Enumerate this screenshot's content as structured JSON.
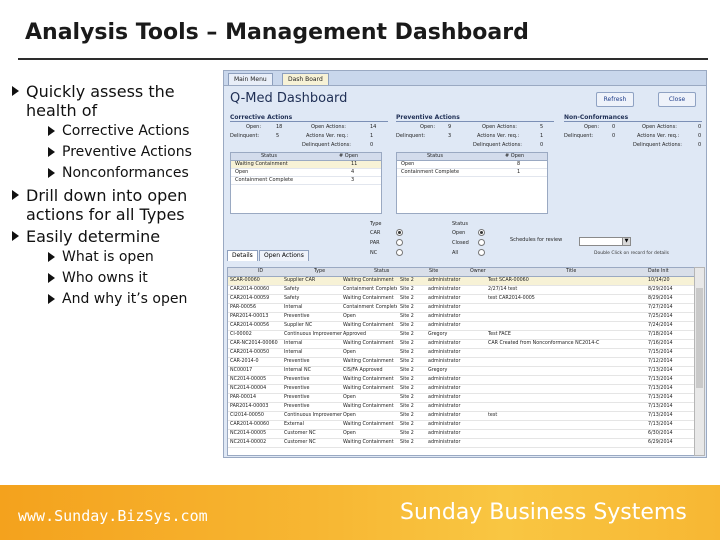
{
  "slide": {
    "title": "Analysis Tools – Management Dashboard",
    "bullets": [
      {
        "text": "Quickly assess the health of",
        "sub": [
          "Corrective Actions",
          "Preventive Actions",
          "Nonconformances"
        ]
      },
      {
        "text": "Drill down into open actions for all Types",
        "sub": []
      },
      {
        "text": "Easily determine",
        "sub": [
          "What is open",
          "Who owns it",
          "And why it’s open"
        ]
      }
    ],
    "footer_url": "www.Sunday.BizSys.com",
    "footer_company": "Sunday Business Systems"
  },
  "app": {
    "tabs": [
      "Main Menu",
      "Dash Board"
    ],
    "title": "Q-Med Dashboard",
    "refresh_label": "Refresh",
    "close_label": "Close",
    "sections": {
      "corrective": {
        "title": "Corrective Actions",
        "open_label": "Open:",
        "open_value": "18",
        "delinquent_label": "Delinquent:",
        "delinquent_value": "5",
        "open_actions_label": "Open Actions:",
        "open_actions_value": "14",
        "actions_ver_label": "Actions Ver. req.:",
        "actions_ver_value": "1",
        "delinquent_actions_label": "Delinquent Actions:",
        "delinquent_actions_value": "0",
        "cols": [
          "Status",
          "# Open"
        ],
        "rows": [
          [
            "Waiting Containment",
            "11"
          ],
          [
            "Open",
            "4"
          ],
          [
            "Containment Complete",
            "3"
          ]
        ]
      },
      "preventive": {
        "title": "Preventive Actions",
        "open_label": "Open:",
        "open_value": "9",
        "delinquent_label": "Delinquent:",
        "delinquent_value": "3",
        "open_actions_label": "Open Actions:",
        "open_actions_value": "5",
        "actions_ver_label": "Actions Ver. req.:",
        "actions_ver_value": "1",
        "delinquent_actions_label": "Delinquent Actions:",
        "delinquent_actions_value": "0",
        "cols": [
          "Status",
          "# Open"
        ],
        "rows": [
          [
            "Open",
            "8"
          ],
          [
            "Containment Complete",
            "1"
          ]
        ]
      },
      "nonconformances": {
        "title": "Non-Conformances",
        "open_label": "Open:",
        "open_value": "0",
        "delinquent_label": "Delinquent:",
        "delinquent_value": "0",
        "open_actions_label": "Open Actions:",
        "open_actions_value": "0",
        "actions_ver_label": "Actions Ver. req.:",
        "actions_ver_value": "0",
        "delinquent_actions_label": "Delinquent Actions:",
        "delinquent_actions_value": "0"
      }
    },
    "type_filter": {
      "label": "Type",
      "options": [
        "CAR",
        "PAR",
        "NC"
      ]
    },
    "status_filter": {
      "label": "Status",
      "options": [
        "Open",
        "Closed",
        "All"
      ]
    },
    "schedule_label": "Schedules for review",
    "note": "Double Click on record for details",
    "detail_tabs": [
      "Details",
      "Open Actions"
    ],
    "grid": {
      "columns": [
        "ID",
        "Type",
        "Status",
        "Site",
        "Owner",
        "Title",
        "Date Init"
      ],
      "rows": [
        [
          "SCAR-00060",
          "Supplier CAR",
          "Waiting Containment",
          "Site 2",
          "administrator",
          "Test SCAR-00060",
          "10/14/20"
        ],
        [
          "CAR2014-00060",
          "Safety",
          "Containment Complete",
          "Site 2",
          "administrator",
          "2/27/14 test",
          "8/29/2014"
        ],
        [
          "CAR2014-00059",
          "Safety",
          "Waiting Containment",
          "Site 2",
          "administrator",
          "test CAR2014-0005",
          "8/29/2014"
        ],
        [
          "PAR-00056",
          "Internal",
          "Containment Complete",
          "Site 2",
          "administrator",
          "",
          "7/27/2014"
        ],
        [
          "PAR2014-00013",
          "Preventive",
          "Open",
          "Site 2",
          "administrator",
          "",
          "7/25/2014"
        ],
        [
          "CAR2014-00056",
          "Supplier NC",
          "Waiting Containment",
          "Site 2",
          "administrator",
          "",
          "7/24/2014"
        ],
        [
          "CI-00002",
          "Continuous Improvement",
          "Approved",
          "Site 2",
          "Gregory",
          "Test FACE",
          "7/18/2014"
        ],
        [
          "CAR-NC2014-00060",
          "Internal",
          "Waiting Containment",
          "Site 2",
          "administrator",
          "CAR Created from Nonconformance NC2014-C",
          "7/16/2014"
        ],
        [
          "CAR2014-00050",
          "Internal",
          "Open",
          "Site 2",
          "administrator",
          "",
          "7/15/2014"
        ],
        [
          "CAR-2014-0",
          "Preventive",
          "Waiting Containment",
          "Site 2",
          "administrator",
          "",
          "7/12/2014"
        ],
        [
          "NC00017",
          "Internal NC",
          "CIS/FA Approved",
          "Site 2",
          "Gregory",
          "",
          "7/13/2014"
        ],
        [
          "NC2014-00005",
          "Preventive",
          "Waiting Containment",
          "Site 2",
          "administrator",
          "",
          "7/13/2014"
        ],
        [
          "NC2014-00004",
          "Preventive",
          "Waiting Containment",
          "Site 2",
          "administrator",
          "",
          "7/13/2014"
        ],
        [
          "PAR-00014",
          "Preventive",
          "Open",
          "Site 2",
          "administrator",
          "",
          "7/13/2014"
        ],
        [
          "PAR2014-00003",
          "Preventive",
          "Waiting Containment",
          "Site 2",
          "administrator",
          "",
          "7/13/2014"
        ],
        [
          "CI2014-00050",
          "Continuous Improvement",
          "Open",
          "Site 2",
          "administrator",
          "test",
          "7/13/2014"
        ],
        [
          "CAR2014-00060",
          "External",
          "Waiting Containment",
          "Site 2",
          "administrator",
          "",
          "7/13/2014"
        ],
        [
          "NC2014-00005",
          "Customer NC",
          "Open",
          "Site 2",
          "administrator",
          "",
          "6/30/2014"
        ],
        [
          "NC2014-00002",
          "Customer NC",
          "Waiting Containment",
          "Site 2",
          "administrator",
          "",
          "6/29/2014"
        ]
      ]
    }
  }
}
